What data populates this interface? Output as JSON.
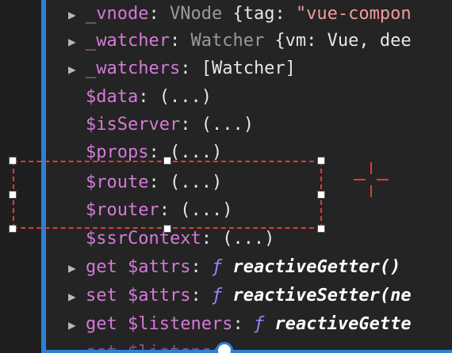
{
  "properties": [
    {
      "caret": "▶",
      "key": "_vnode",
      "colon": ":",
      "cls": "VNode",
      "rest": " {tag: ",
      "str": "\"vue-compon"
    },
    {
      "caret": "▶",
      "key": "_watcher",
      "colon": ":",
      "cls": "Watcher",
      "rest": " {vm: Vue, dee"
    },
    {
      "caret": "▶",
      "key": "_watchers",
      "colon": ":",
      "rest": " [Watcher]"
    },
    {
      "key": "$data",
      "colon": ":",
      "rest": " (...)"
    },
    {
      "key": "$isServer",
      "colon": ":",
      "rest": " (...)"
    },
    {
      "key": "$props",
      "colon": ":",
      "rest": " (...)"
    },
    {
      "key": "$route",
      "colon": ":",
      "rest": " (...)"
    },
    {
      "key": "$router",
      "colon": ":",
      "rest": " (...)"
    },
    {
      "key": "$ssrContext",
      "colon": ":",
      "rest": " (...)"
    },
    {
      "caret": "▶",
      "kw": "get",
      "key": "$attrs",
      "colon": ":",
      "fn": "ƒ",
      "getter": "reactiveGetter()"
    },
    {
      "caret": "▶",
      "kw": "set",
      "key": "$attrs",
      "colon": ":",
      "fn": "ƒ",
      "getter": "reactiveSetter(ne"
    },
    {
      "caret": "▶",
      "kw": "get",
      "key": "$listeners",
      "colon": ":",
      "fn": "ƒ",
      "getter": "reactiveGette"
    }
  ],
  "colors": {
    "accent": "#2f80d4",
    "selection": "#e53935",
    "key": "#d47ad8",
    "string": "#f29b9b"
  },
  "icons": {
    "expand": "caret-right-icon",
    "crosshair": "crosshair-icon"
  }
}
